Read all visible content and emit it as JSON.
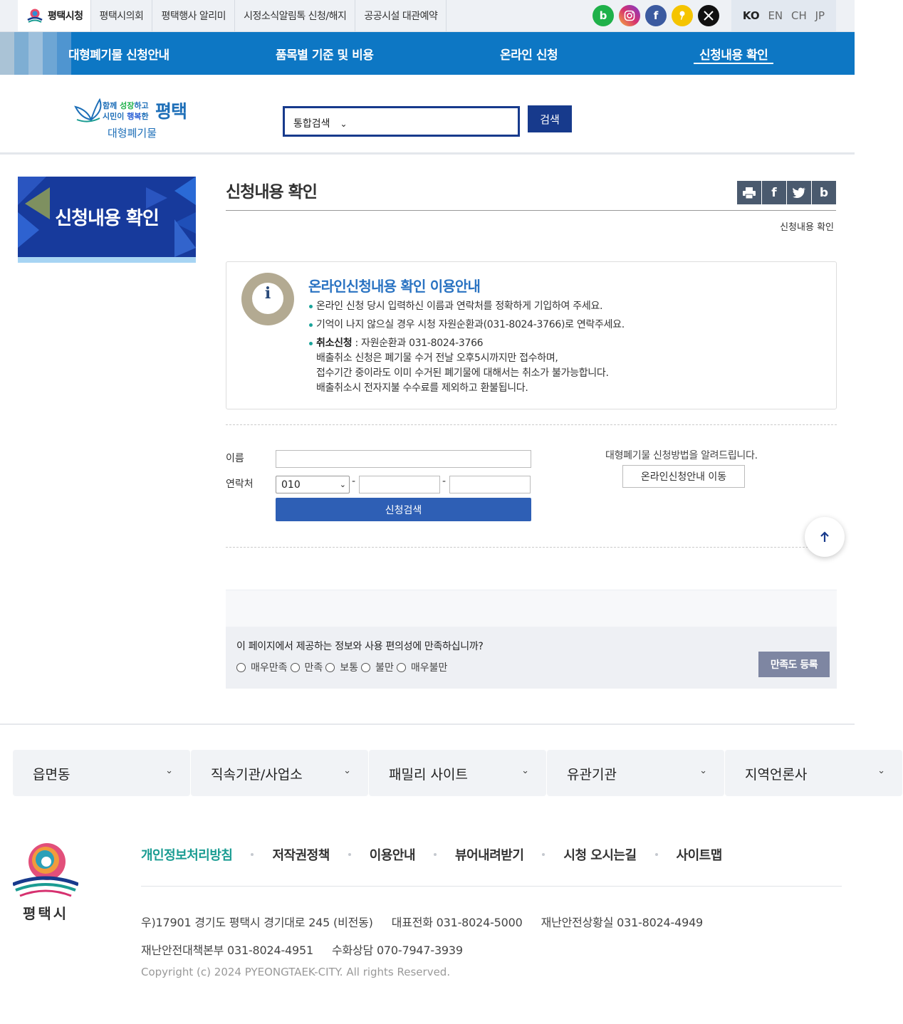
{
  "topbar": {
    "links": [
      "평택시청",
      "평택시의회",
      "평택행사 알리미",
      "시정소식알림톡 신청/해지",
      "공공시설 대관예약"
    ],
    "sns": [
      {
        "icon": "blog-icon",
        "glyph": "b",
        "color": "#1fb14a"
      },
      {
        "icon": "instagram-icon",
        "glyph": "◎",
        "color": "#d6316f"
      },
      {
        "icon": "facebook-icon",
        "glyph": "f",
        "color": "#3b5aa0"
      },
      {
        "icon": "kakao-icon",
        "glyph": "❜",
        "color": "#f5c400"
      },
      {
        "icon": "x-icon",
        "glyph": "𝕏",
        "color": "#111111"
      }
    ],
    "languages": [
      "KO",
      "EN",
      "CH",
      "JP"
    ]
  },
  "gnb": {
    "items": [
      "대형폐기물 신청안내",
      "품목별 기준 및 비용",
      "온라인 신청",
      "신청내용 확인"
    ]
  },
  "header": {
    "logo_line1_a": "함께",
    "logo_line1_b": "성장",
    "logo_line1_c": "하고",
    "logo_line2_a": "시민이",
    "logo_line2_b": "행복",
    "logo_line2_c": "한",
    "logo_city": "평택",
    "logo_sub": "대형폐기물",
    "search_select": "통합검색",
    "search_button": "검색"
  },
  "lnb": {
    "banner_title": "신청내용 확인"
  },
  "content": {
    "title": "신청내용 확인",
    "breadcrumb": "신청내용 확인",
    "share_icons": [
      "print-icon",
      "facebook-icon",
      "twitter-icon",
      "blog-icon"
    ]
  },
  "info": {
    "heading": "온라인신청내용 확인 이용안내",
    "item1": "온라인 신청 당시 입력하신 이름과 연락처를 정확하게 기입하여 주세요.",
    "item2": "기억이 나지 않으실 경우 시청 자원순환과(031-8024-3766)로 연락주세요.",
    "item3_bold": "취소신청",
    "item3_rest": " : 자원순환과 031-8024-3766",
    "item3_line2": "배출취소 신청은 폐기물 수거 전날 오후5시까지만 접수하며,",
    "item3_line3": "접수기간 중이라도 이미 수거된 폐기물에 대해서는 취소가 불가능합니다.",
    "item3_line4": "배출취소시 전자지불 수수료를 제외하고 환불됩니다."
  },
  "form": {
    "name_label": "이름",
    "phone_label": "연락처",
    "phone_prefix": "010",
    "hyphen": "-",
    "submit": "신청검색",
    "guide_text": "대형폐기물 신청방법을 알려드립니다.",
    "guide_button": "온라인신청안내 이동"
  },
  "satisfaction": {
    "question": "이 페이지에서 제공하는 정보와 사용 편의성에 만족하십니까?",
    "options": [
      "매우만족",
      "만족",
      "보통",
      "불만",
      "매우불만"
    ],
    "button": "만족도 등록"
  },
  "footer": {
    "dropdowns": [
      "읍면동",
      "직속기관/사업소",
      "패밀리 사이트",
      "유관기관",
      "지역언론사"
    ],
    "logo_text": "평택시",
    "links": [
      "개인정보처리방침",
      "저작권정책",
      "이용안내",
      "뷰어내려받기",
      "시청 오시는길",
      "사이트맵"
    ],
    "addr1": "우)17901 경기도 평택시 경기대로 245 (비전동)",
    "tel_main": "대표전화 031-8024-5000",
    "tel_disaster": "재난안전상황실 031-8024-4949",
    "tel_hq": "재난안전대책본부 031-8024-4951",
    "tel_sign": "수화상담 070-7947-3939",
    "copyright": "Copyright (c) 2024 PYEONGTAEK-CITY. All rights Reserved."
  }
}
